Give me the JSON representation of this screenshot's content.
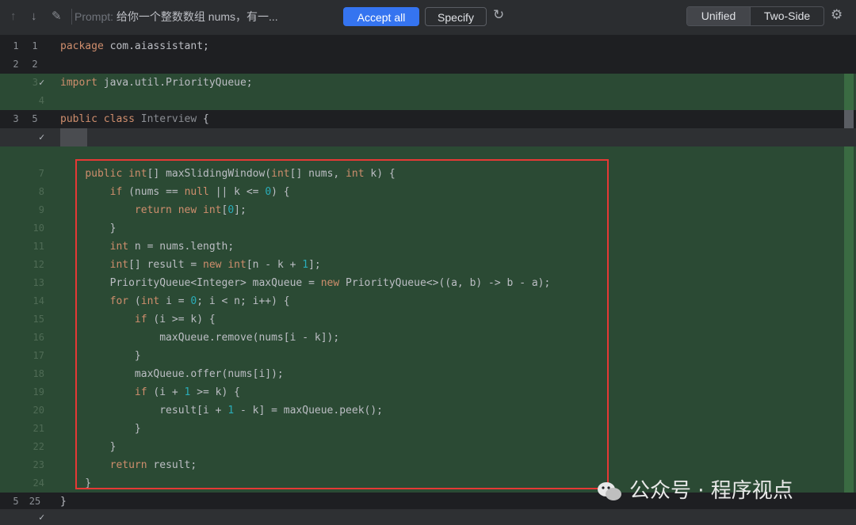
{
  "toolbar": {
    "prompt_label": "Prompt:",
    "prompt_text": "给你一个整数数组 nums，有一...",
    "accept_all": "Accept all",
    "specify": "Specify",
    "view_unified": "Unified",
    "view_two_side": "Two-Side"
  },
  "rows": [
    {
      "old": "1",
      "new": "1",
      "code": "package com.aiassistant;"
    },
    {
      "old": "2",
      "new": "2",
      "code": ""
    },
    {
      "single": "3",
      "check": "✓",
      "code": "import java.util.PriorityQueue;"
    },
    {
      "single": "4",
      "code": ""
    },
    {
      "old": "3",
      "new": "5",
      "code": "public class Interview {"
    },
    {
      "single": "",
      "check": "✓",
      "code": ""
    },
    {
      "single": "",
      "code": ""
    },
    {
      "single": "7",
      "code": "    public int[] maxSlidingWindow(int[] nums, int k) {"
    },
    {
      "single": "8",
      "code": "        if (nums == null || k <= 0) {"
    },
    {
      "single": "9",
      "code": "            return new int[0];"
    },
    {
      "single": "10",
      "code": "        }"
    },
    {
      "single": "11",
      "code": "        int n = nums.length;"
    },
    {
      "single": "12",
      "code": "        int[] result = new int[n - k + 1];"
    },
    {
      "single": "13",
      "code": "        PriorityQueue<Integer> maxQueue = new PriorityQueue<>((a, b) -> b - a);"
    },
    {
      "single": "14",
      "code": "        for (int i = 0; i < n; i++) {"
    },
    {
      "single": "15",
      "code": "            if (i >= k) {"
    },
    {
      "single": "16",
      "code": "                maxQueue.remove(nums[i - k]);"
    },
    {
      "single": "17",
      "code": "            }"
    },
    {
      "single": "18",
      "code": "            maxQueue.offer(nums[i]);"
    },
    {
      "single": "19",
      "code": "            if (i + 1 >= k) {"
    },
    {
      "single": "20",
      "code": "                result[i + 1 - k] = maxQueue.peek();"
    },
    {
      "single": "21",
      "code": "            }"
    },
    {
      "single": "22",
      "code": "        }"
    },
    {
      "single": "23",
      "code": "        return result;"
    },
    {
      "single": "24",
      "code": "    }"
    },
    {
      "old": "5",
      "new": "25",
      "code": "}"
    }
  ],
  "watermark": {
    "text": "公众号 · 程序视点"
  },
  "colors": {
    "added_bg": "#2b4a34",
    "accent": "#3574f0",
    "highlight_box": "#e53935"
  }
}
